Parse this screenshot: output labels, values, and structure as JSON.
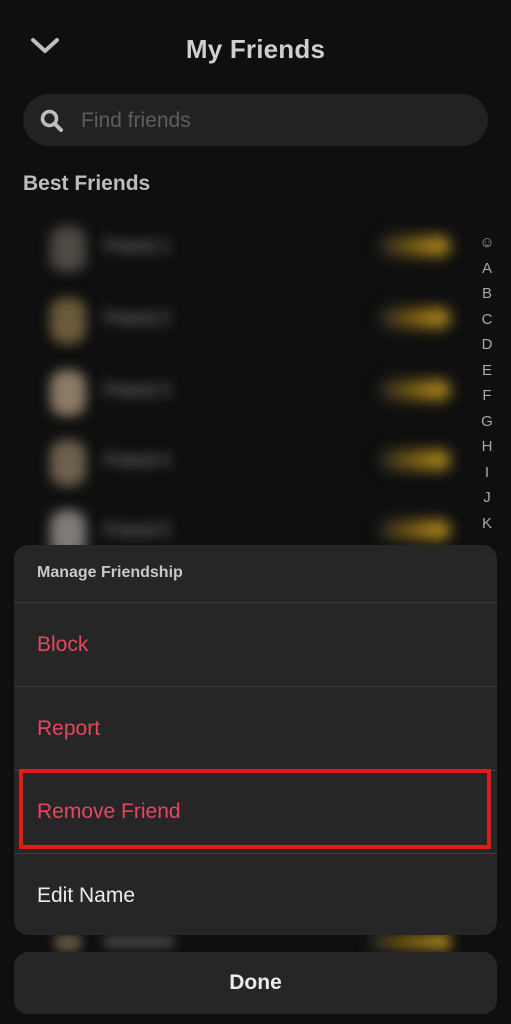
{
  "header": {
    "title": "My Friends"
  },
  "search": {
    "placeholder": "Find friends"
  },
  "best_friends": {
    "section_title": "Best Friends",
    "friends": [
      {
        "name": "Friend 1"
      },
      {
        "name": "Friend 2"
      },
      {
        "name": "Friend 3"
      },
      {
        "name": "Friend 4"
      },
      {
        "name": "Friend 5"
      }
    ]
  },
  "alphabet_index": [
    "☺",
    "A",
    "B",
    "C",
    "D",
    "E",
    "F",
    "G",
    "H",
    "I",
    "J",
    "K"
  ],
  "manage_sheet": {
    "title": "Manage Friendship",
    "block_label": "Block",
    "report_label": "Report",
    "remove_label": "Remove Friend",
    "edit_name_label": "Edit Name"
  },
  "done_label": "Done",
  "colors": {
    "danger": "#e6475f",
    "highlight": "#e11a1a"
  },
  "icons": {
    "back": "chevron-down-icon",
    "search": "search-icon"
  }
}
